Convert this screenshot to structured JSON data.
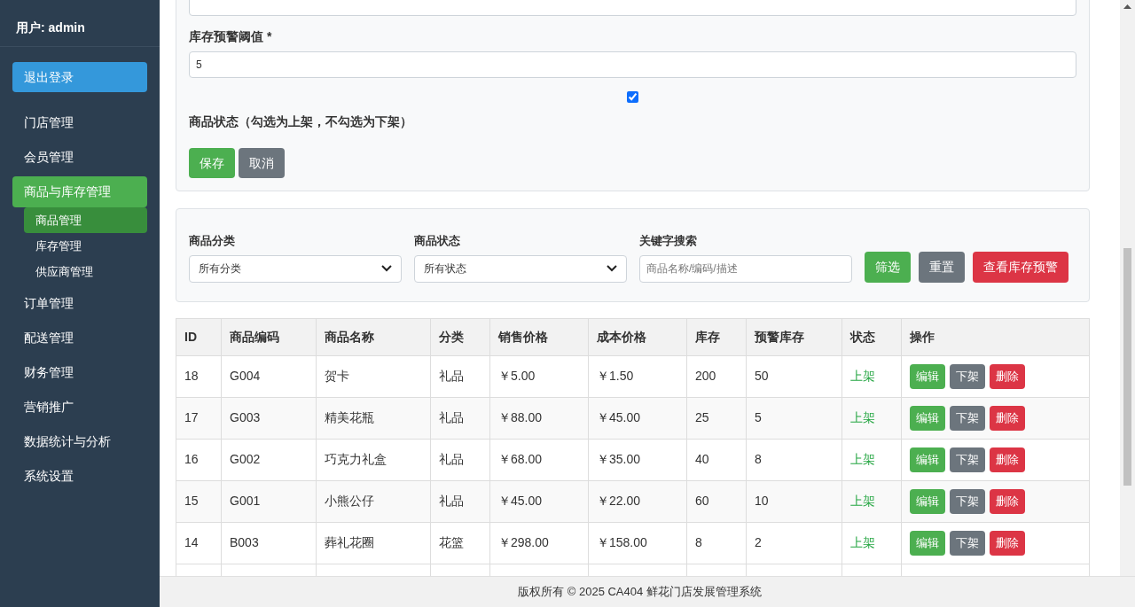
{
  "sidebar": {
    "user": "用户: admin",
    "logout": "退出登录",
    "items": [
      {
        "label": "门店管理",
        "selected": false
      },
      {
        "label": "会员管理",
        "selected": false
      },
      {
        "label": "商品与库存管理",
        "selected": true,
        "children": [
          {
            "label": "商品管理",
            "selected": true
          },
          {
            "label": "库存管理",
            "selected": false
          },
          {
            "label": "供应商管理",
            "selected": false
          }
        ]
      },
      {
        "label": "订单管理",
        "selected": false
      },
      {
        "label": "配送管理",
        "selected": false
      },
      {
        "label": "财务管理",
        "selected": false
      },
      {
        "label": "营销推广",
        "selected": false
      },
      {
        "label": "数据统计与分析",
        "selected": false
      },
      {
        "label": "系统设置",
        "selected": false
      }
    ]
  },
  "form": {
    "threshold_label": "库存预警阈值 *",
    "threshold_value": "5",
    "status_checked": true,
    "status_label": "商品状态（勾选为上架，不勾选为下架）",
    "buttons": [
      {
        "label": "保存",
        "kind": "success"
      },
      {
        "label": "取消",
        "kind": "secondary"
      }
    ]
  },
  "filters": {
    "category_label": "商品分类",
    "category_value": "所有分类",
    "status_label": "商品状态",
    "status_value": "所有状态",
    "keyword_label": "关键字搜索",
    "keyword_placeholder": "商品名称/编码/描述",
    "buttons": [
      {
        "label": "筛选",
        "kind": "success"
      },
      {
        "label": "重置",
        "kind": "secondary"
      },
      {
        "label": "查看库存预警",
        "kind": "danger"
      }
    ]
  },
  "table": {
    "columns": [
      "ID",
      "商品编码",
      "商品名称",
      "分类",
      "销售价格",
      "成本价格",
      "库存",
      "预警库存",
      "状态",
      "操作"
    ],
    "rows": [
      {
        "cells": [
          "18",
          "G004",
          "贺卡",
          "礼品",
          "￥5.00",
          "￥1.50",
          "200",
          "50"
        ],
        "status": "上架",
        "on_sale": true,
        "actions": [
          "编辑",
          "下架",
          "删除"
        ]
      },
      {
        "cells": [
          "17",
          "G003",
          "精美花瓶",
          "礼品",
          "￥88.00",
          "￥45.00",
          "25",
          "5"
        ],
        "status": "上架",
        "on_sale": true,
        "actions": [
          "编辑",
          "下架",
          "删除"
        ]
      },
      {
        "cells": [
          "16",
          "G002",
          "巧克力礼盒",
          "礼品",
          "￥68.00",
          "￥35.00",
          "40",
          "8"
        ],
        "status": "上架",
        "on_sale": true,
        "actions": [
          "编辑",
          "下架",
          "删除"
        ]
      },
      {
        "cells": [
          "15",
          "G001",
          "小熊公仔",
          "礼品",
          "￥45.00",
          "￥22.00",
          "60",
          "10"
        ],
        "status": "上架",
        "on_sale": true,
        "actions": [
          "编辑",
          "下架",
          "删除"
        ]
      },
      {
        "cells": [
          "14",
          "B003",
          "葬礼花圈",
          "花篮",
          "￥298.00",
          "￥158.00",
          "8",
          "2"
        ],
        "status": "上架",
        "on_sale": true,
        "actions": [
          "编辑",
          "下架",
          "删除"
        ]
      }
    ]
  },
  "footer": "版权所有 © 2025 CA404 鲜花门店发展管理系统"
}
